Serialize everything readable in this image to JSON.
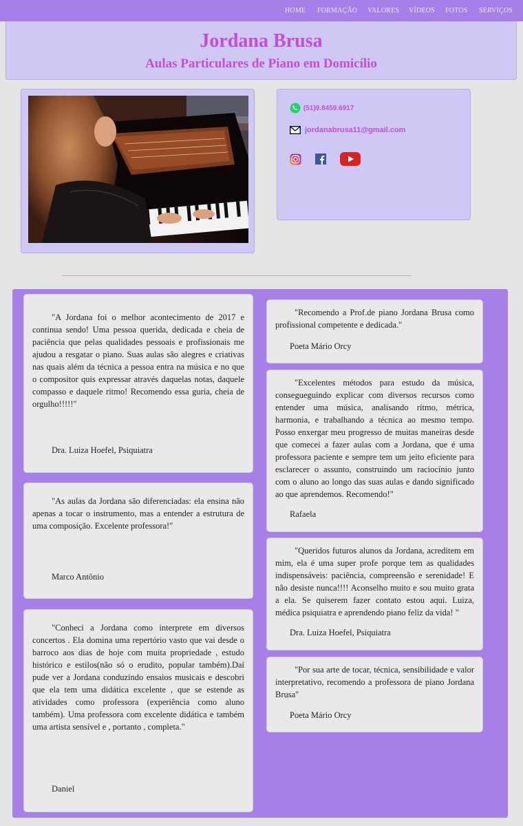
{
  "nav": {
    "items": [
      "HOME",
      "FORMAÇÃO",
      "VALORES",
      "VÍDEOS",
      "FOTOS",
      "SERVIÇOS"
    ]
  },
  "header": {
    "title": "Jordana Brusa",
    "subtitle": "Aulas Particulares de Piano em Domicílio"
  },
  "contact": {
    "phone": "(51)9.8459.6917",
    "email": "jordanabrusa11@gmail.com",
    "social": [
      "instagram-icon",
      "facebook-icon",
      "youtube-icon"
    ]
  },
  "testimonials": {
    "left": [
      {
        "quote": "\"A Jordana foi o melhor acontecimento de 2017 e continua sendo! Uma pessoa querida, dedicada e cheia de paciência que pelas qualidades pessoais e profissionais me ajudou a resgatar o piano. Suas aulas são alegres e criativas nas quais além da técnica a pessoa entra na música e no que o compositor quis expressar através daquelas notas, daquele compasso e daquele ritmo! Recomendo essa guria, cheia de orgulho!!!!!\"",
        "author": "Dra. Luiza Hoefel, Psiquiatra"
      },
      {
        "quote": "\"As aulas da Jordana são diferenciadas: ela ensina não apenas a tocar o instrumento, mas a entender a estrutura de uma composição. Excelente professora!\"",
        "author": "Marco Antônio"
      },
      {
        "quote": "\"Conheci a Jordana como interprete em diversos concertos . Ela domina uma repertório vasto que vai desde o barroco aos dias de hoje com muita propriedade , estudo histórico e estilos(não só o erudito, popular também).Daí pude ver a Jordana conduzindo ensaios musicais e descobri que ela tem uma didática excelente , que se estende as atividades como professora (experiência como aluno também). Uma professora com excelente didática e também uma artista sensível e , portanto , completa.\"",
        "author": "Daniel"
      }
    ],
    "right": [
      {
        "quote": "\"Recomendo a Prof.de piano Jordana Brusa como profissional competente e dedicada.\"",
        "author": "Poeta Mário Orcy"
      },
      {
        "quote": "\"Excelentes métodos para estudo da música, consegueguindo explicar com diversos recursos como entender uma música, analisando rítmo, métrica, harmonia, e trabalhando a técnica ao mesmo tempo. Posso enxergar meu progresso de muitas maneiras desde que comecei a fazer aulas com a Jordana, que é uma professora paciente e sempre tem um jeito eficiente para esclarecer o assunto, construindo um raciocínio junto com o aluno ao longo das suas aulas e dando significado ao que aprendemos. Recomendo!\"",
        "author": "Rafaela"
      },
      {
        "quote": "\"Queridos futuros alunos da Jordana, acreditem em mim, ela é uma super profe porque tem as qualidades indispensáveis: paciência, compreensão e serenidade! E não desiste nunca!!!! Aconselho muito e sou muito grata a ela. Se quiserem fazer contato estou aqui. Luiza, médica psiquiatra e aprendendo piano feliz da vida! \"",
        "author": "Dra. Luiza Hoefel, Psiquiatra"
      },
      {
        "quote": "\"Por sua arte de tocar, técnica, sensibilidade e valor interpretativo, recomendo a professora de piano Jordana Brusa\"",
        "author": "Poeta Mário Orcy"
      }
    ]
  },
  "colors": {
    "nav_bg": "#a77fe8",
    "panel_bg": "#cfc7f4",
    "accent_text": "#c24dd8",
    "testimonial_bg": "#a77fe8",
    "card_bg": "#e9e9e9"
  }
}
